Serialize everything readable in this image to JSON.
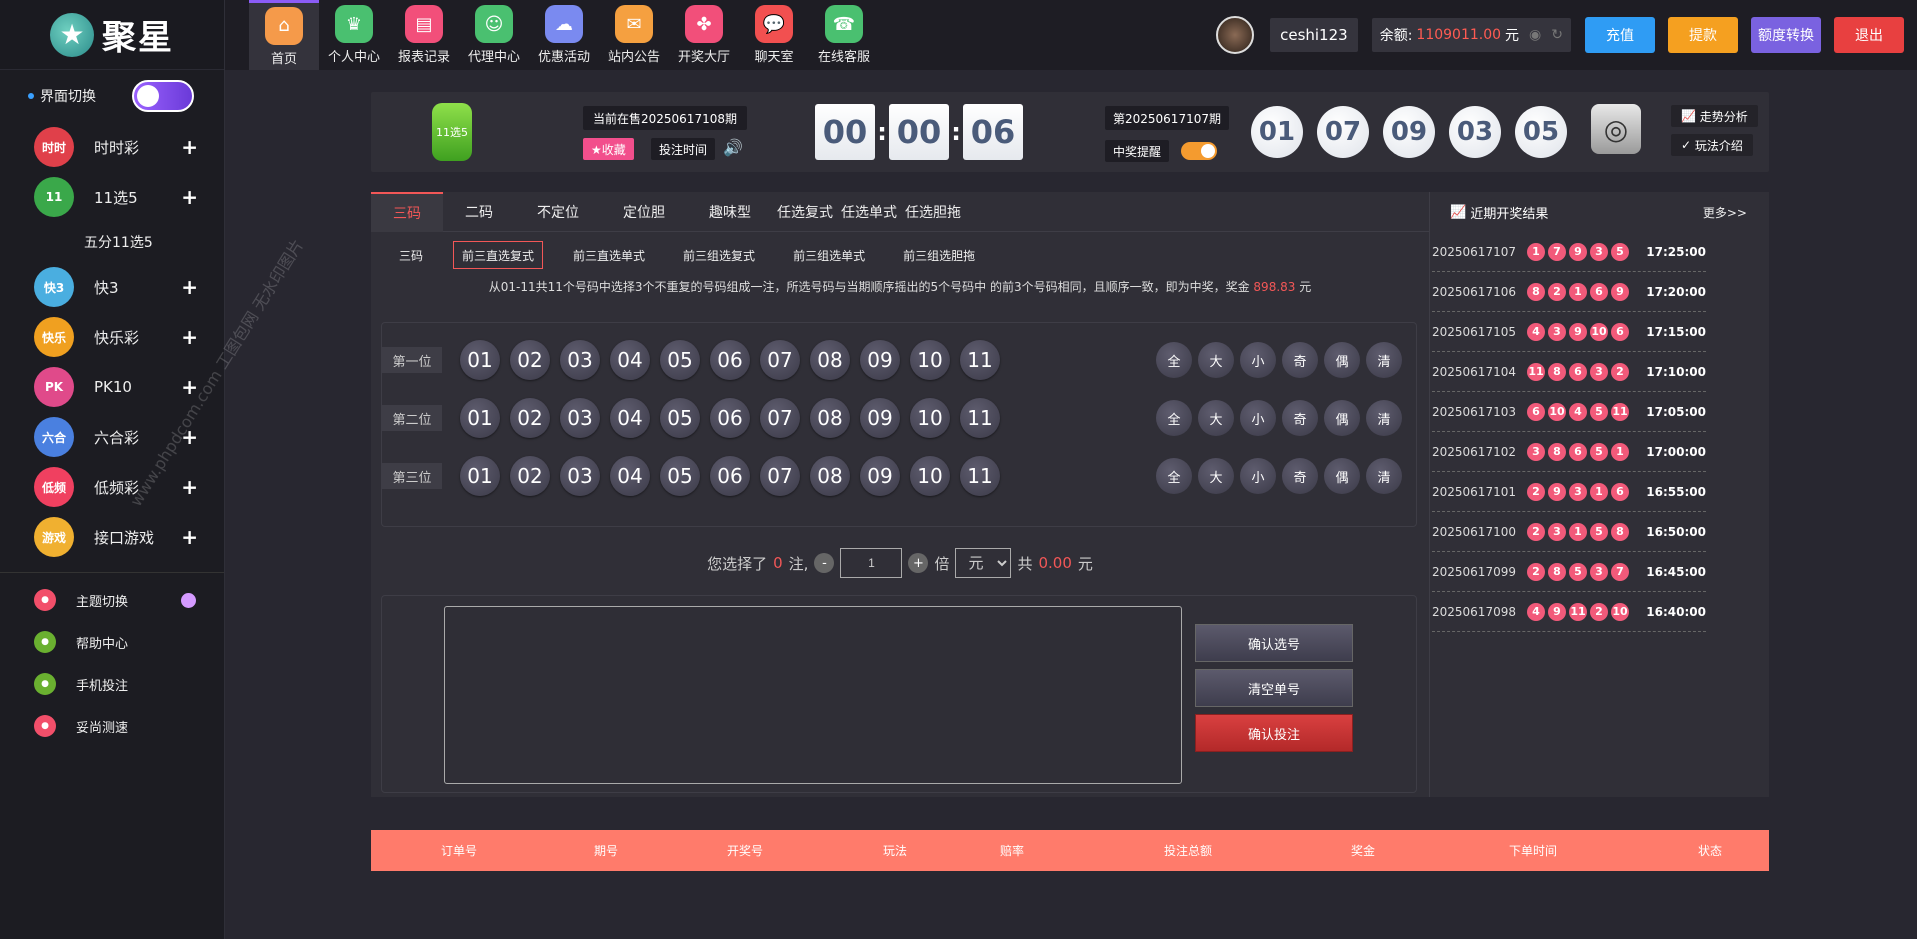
{
  "sidebar": {
    "logo_text": "聚星",
    "switch_label": "界面切换",
    "games": [
      {
        "label": "时时彩",
        "icon": "ssc-icon",
        "icon_text": "时时",
        "color": "#e0404a"
      },
      {
        "label": "11选5",
        "icon": "11x5-icon",
        "icon_text": "11",
        "color": "#3aa84a"
      },
      {
        "label": "快3",
        "icon": "k3-icon",
        "icon_text": "快3",
        "color": "#4aaee0"
      },
      {
        "label": "快乐彩",
        "icon": "klc-icon",
        "icon_text": "快乐",
        "color": "#f0a020"
      },
      {
        "label": "PK10",
        "icon": "pk10-icon",
        "icon_text": "PK",
        "color": "#e04a8a"
      },
      {
        "label": "六合彩",
        "icon": "lhc-icon",
        "icon_text": "六合",
        "color": "#4a80e0"
      },
      {
        "label": "低频彩",
        "icon": "dpc-icon",
        "icon_text": "低频",
        "color": "#f04060"
      },
      {
        "label": "接口游戏",
        "icon": "api-game-icon",
        "icon_text": "游戏",
        "color": "#f0b030"
      }
    ],
    "sub_item": "五分11选5",
    "utils": [
      {
        "label": "主题切换",
        "icon": "theme-icon",
        "color": "#f24f6a"
      },
      {
        "label": "帮助中心",
        "icon": "help-icon",
        "color": "#6ab030"
      },
      {
        "label": "手机投注",
        "icon": "mobile-bet-icon",
        "color": "#6ab030"
      },
      {
        "label": "妥尚测速",
        "icon": "speed-test-icon",
        "color": "#f24f6a"
      }
    ]
  },
  "topnav": {
    "items": [
      {
        "label": "首页",
        "icon": "home-icon",
        "color": "#f59a4a"
      },
      {
        "label": "个人中心",
        "icon": "crown-icon",
        "color": "#4ac070"
      },
      {
        "label": "报表记录",
        "icon": "report-icon",
        "color": "#f24f7a"
      },
      {
        "label": "代理中心",
        "icon": "agent-icon",
        "color": "#4ac070"
      },
      {
        "label": "优惠活动",
        "icon": "promo-icon",
        "color": "#7a8af0"
      },
      {
        "label": "站内公告",
        "icon": "mail-icon",
        "color": "#f5a040"
      },
      {
        "label": "开奖大厅",
        "icon": "lottery-hall-icon",
        "color": "#f24f7a"
      },
      {
        "label": "聊天室",
        "icon": "chat-icon",
        "color": "#f25050"
      },
      {
        "label": "在线客服",
        "icon": "service-icon",
        "color": "#4ac070"
      }
    ],
    "username": "ceshi123",
    "balance_label": "余额:",
    "balance_value": "1109011.00",
    "balance_unit": "元",
    "buttons": [
      {
        "label": "充值",
        "color": "#2f9cf4"
      },
      {
        "label": "提款",
        "color": "#f5a020"
      },
      {
        "label": "额度转换",
        "color": "#7a62e0"
      },
      {
        "label": "退出",
        "color": "#e84040"
      }
    ]
  },
  "lottery": {
    "logo_text": "11选5",
    "current_issue": "当前在售20250617108期",
    "fav_label": "★收藏",
    "bet_time_label": "投注时间",
    "timer": [
      "00",
      "00",
      "06"
    ],
    "last_issue": "第20250617107期",
    "prize_remind": "中奖提醒",
    "last_balls": [
      "01",
      "07",
      "09",
      "03",
      "05"
    ],
    "trend_label": "走势分析",
    "rule_label": "玩法介绍"
  },
  "play": {
    "tabs": [
      "三码",
      "二码",
      "不定位",
      "定位胆",
      "趣味型",
      "任选复式",
      "任选单式",
      "任选胆拖"
    ],
    "subtabs": [
      "三码",
      "前三直选复式",
      "前三直选单式",
      "前三组选复式",
      "前三组选单式",
      "前三组选胆拖"
    ],
    "desc_pre": "从01-11共11个号码中选择3个不重复的号码组成一注，所选号码与当期顺序摇出的5个号码中 的前3个号码相同，且顺序一致，即为中奖，奖金",
    "desc_prize": "898.83",
    "desc_unit": "元",
    "rows": [
      "第一位",
      "第二位",
      "第三位"
    ],
    "numbers": [
      "01",
      "02",
      "03",
      "04",
      "05",
      "06",
      "07",
      "08",
      "09",
      "10",
      "11"
    ],
    "quick": [
      "全",
      "大",
      "小",
      "奇",
      "偶",
      "清"
    ],
    "bet_pre": "您选择了",
    "bet_count": "0",
    "bet_mid": "注,",
    "minus": "-",
    "multiple": "1",
    "plus": "+",
    "times_label": "倍",
    "unit": "元",
    "total_label": "共",
    "total_value": "0.00",
    "total_unit": "元",
    "confirm_select": "确认选号",
    "clear": "清空单号",
    "confirm_bet": "确认投注"
  },
  "recent": {
    "title": "近期开奖结果",
    "more": "更多>>",
    "rows": [
      {
        "issue": "20250617107",
        "balls": [
          "1",
          "7",
          "9",
          "3",
          "5"
        ],
        "time": "17:25:00"
      },
      {
        "issue": "20250617106",
        "balls": [
          "8",
          "2",
          "1",
          "6",
          "9"
        ],
        "time": "17:20:00"
      },
      {
        "issue": "20250617105",
        "balls": [
          "4",
          "3",
          "9",
          "10",
          "6"
        ],
        "time": "17:15:00"
      },
      {
        "issue": "20250617104",
        "balls": [
          "11",
          "8",
          "6",
          "3",
          "2"
        ],
        "time": "17:10:00"
      },
      {
        "issue": "20250617103",
        "balls": [
          "6",
          "10",
          "4",
          "5",
          "11"
        ],
        "time": "17:05:00"
      },
      {
        "issue": "20250617102",
        "balls": [
          "3",
          "8",
          "6",
          "5",
          "1"
        ],
        "time": "17:00:00"
      },
      {
        "issue": "20250617101",
        "balls": [
          "2",
          "9",
          "3",
          "1",
          "6"
        ],
        "time": "16:55:00"
      },
      {
        "issue": "20250617100",
        "balls": [
          "2",
          "3",
          "1",
          "5",
          "8"
        ],
        "time": "16:50:00"
      },
      {
        "issue": "20250617099",
        "balls": [
          "2",
          "8",
          "5",
          "3",
          "7"
        ],
        "time": "16:45:00"
      },
      {
        "issue": "20250617098",
        "balls": [
          "4",
          "9",
          "11",
          "2",
          "10"
        ],
        "time": "16:40:00"
      }
    ]
  },
  "orders": {
    "columns": [
      "订单号",
      "期号",
      "开奖号",
      "玩法",
      "赔率",
      "投注总额",
      "奖金",
      "下单时间",
      "状态"
    ]
  },
  "watermark": "www.phpdcom.com 工图包网 无水印图片"
}
